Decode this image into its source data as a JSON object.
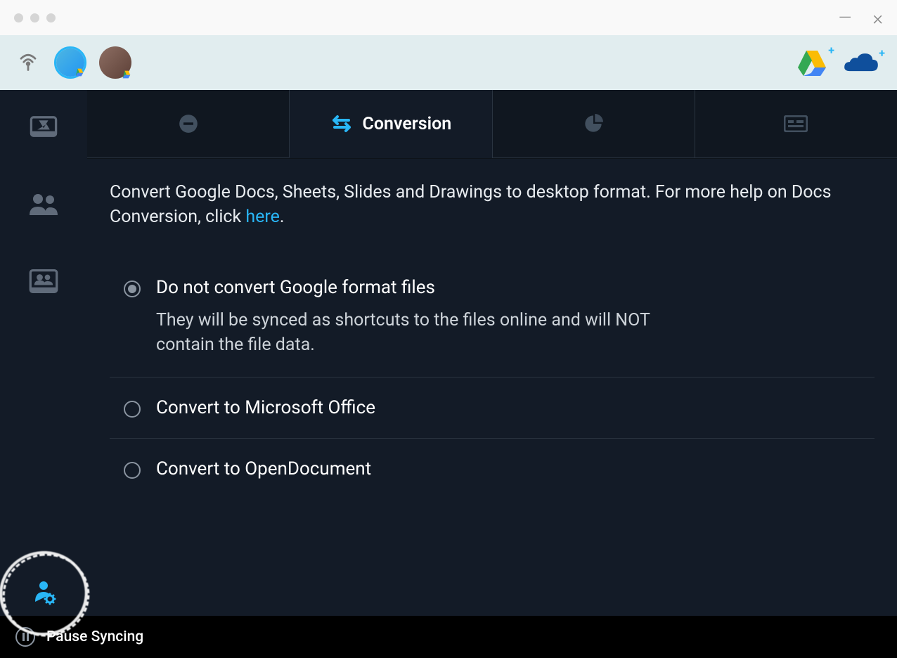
{
  "tabs": {
    "conversion_label": "Conversion"
  },
  "description": {
    "text_prefix": "Convert Google Docs, Sheets, Slides and Drawings to desktop format. For more help on Docs Conversion, click ",
    "link_text": "here",
    "text_suffix": "."
  },
  "options": [
    {
      "label": "Do not convert Google format files",
      "sublabel": "They will be synced as shortcuts to the files online and will NOT contain the file data.",
      "selected": true
    },
    {
      "label": "Convert to Microsoft Office",
      "sublabel": "",
      "selected": false
    },
    {
      "label": "Convert to OpenDocument",
      "sublabel": "",
      "selected": false
    }
  ],
  "footer": {
    "pause_label": "Pause Syncing"
  }
}
